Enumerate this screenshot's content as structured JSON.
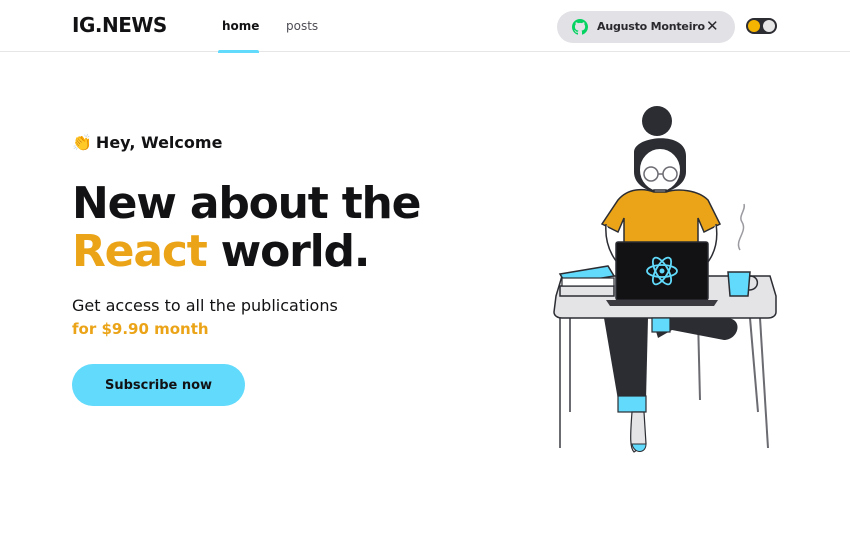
{
  "header": {
    "logo": "IG.NEWS",
    "nav": [
      {
        "label": "home",
        "active": true
      },
      {
        "label": "posts",
        "active": false
      }
    ],
    "user": {
      "name": "Augusto Monteiro",
      "provider_icon": "github-icon",
      "close_icon": "close-icon",
      "close_glyph": "✕"
    },
    "theme_toggle": {
      "icon": "sun-icon"
    }
  },
  "hero": {
    "welcome_emoji": "👏",
    "welcome": "Hey, Welcome",
    "headline_line1": "New about the",
    "headline_accent": "React",
    "headline_line2_rest": " world.",
    "subtitle": "Get access to all the publications",
    "price": "for $9.90 month",
    "cta": "Subscribe now"
  },
  "colors": {
    "accent_yellow": "#eba417",
    "accent_cyan": "#61dafb",
    "text_dark": "#121214",
    "pill_bg": "#e1e1e6"
  }
}
